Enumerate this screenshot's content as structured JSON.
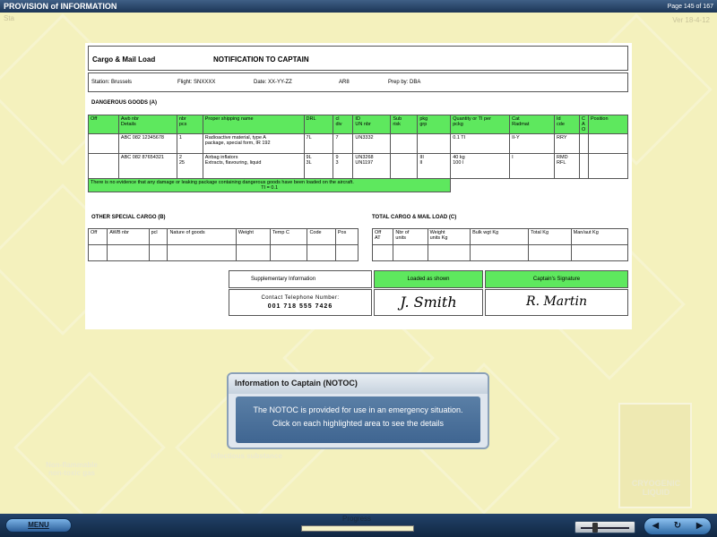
{
  "app": {
    "title": "PROVISION of INFORMATION",
    "page_indicator": "Page 145 of 167",
    "station_code": "Sta",
    "version": "Ver 18-4-12"
  },
  "document": {
    "header_left": "Cargo & Mail Load",
    "header_center": "NOTIFICATION TO CAPTAIN",
    "station": "Station: Brussels",
    "flight": "Flight: SNXXXX",
    "date": "Date: XX-YY-ZZ",
    "ar": "AR8",
    "prep": "Prep by: DBA",
    "dg_section": "DANGEROUS GOODS (A)",
    "dg_headers": [
      "Off",
      "Awb nbr\nDetails",
      "nbr\npcs",
      "Proper shipping name",
      "DRL",
      "cl\ndiv",
      "ID\nUN nbr",
      "Sub\nrisk",
      "pkg\ngrp",
      "Quantity or TI per\npckg",
      "Cat\nRadmat",
      "Id\ncde",
      "C\nA\nO",
      "Position"
    ],
    "dg_rows": [
      [
        "",
        "ABC 082 12345678",
        "1",
        "Radioactive material, type A\npackage, special form, IR 192",
        "7L",
        "7",
        "UN3332",
        "",
        "",
        "0.1 TI",
        "II-Y",
        "RRY",
        "",
        ""
      ],
      [
        "",
        "ABC 082 87654321",
        "2\n25",
        "Airbag inflators\nExtracts, flavouring, liquid",
        "9L\n3L",
        "9\n3",
        "UN3268\nUN1197",
        "",
        "III\nII",
        "40 kg\n100 l",
        "I",
        "RMD\nRFL",
        "",
        ""
      ]
    ],
    "dg_note": "There is no evidence that any damage or leaking package containing dangerous goods have been loaded on the aircraft.",
    "dg_ti": "TI = 0.1",
    "osc_section": "OTHER SPECIAL CARGO (B)",
    "osc_headers": [
      "Off",
      "AWB nbr",
      "pcl",
      "Nature of goods",
      "Weight",
      "Temp C",
      "Code",
      "Pos"
    ],
    "tcm_section": "TOTAL CARGO & MAIL LOAD (C)",
    "tcm_headers": [
      "Off\nAT",
      "Nbr of\nunits",
      "Weight\nunits Kg",
      "Bulk wgt Kg",
      "Total Kg",
      "Man/aut Kg"
    ],
    "supp_info": "Supplementary Information",
    "loaded_as_shown": "Loaded as shown",
    "captains_signature": "Captain's Signature",
    "contact_label": "Contact Telephone Number:",
    "contact_number": "001 718 555 7426",
    "signature_loader": "J. Smith",
    "signature_captain": "R. Martin"
  },
  "popup": {
    "title": "Information to Captain (NOTOC)",
    "line1": "The NOTOC is provided for use in an emergency situation.",
    "line2": "Click on each highlighted area to see the details"
  },
  "background_labels": {
    "cryogenic": "CRYOGENIC\nLIQUID",
    "non_flammable": "Non-flammable\nnon-toxic gas",
    "infectious": "Infectious substance"
  },
  "bottom": {
    "menu_label": "MENU",
    "progress_label": "Progress",
    "progress_fraction": 0.0,
    "slider_fraction": 0.25
  },
  "colors": {
    "highlight_green": "#5ee85e",
    "background": "#f4f1bd",
    "titlebar": "#1c3556"
  }
}
